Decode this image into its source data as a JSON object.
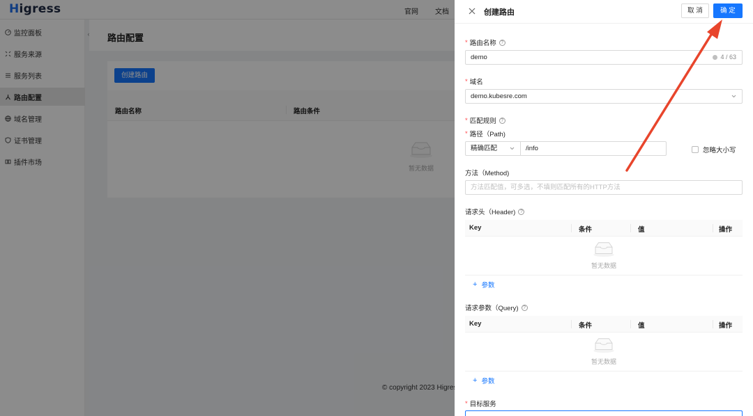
{
  "app": {
    "logo": {
      "first": "H",
      "rest": "igress"
    },
    "top_links": [
      "官网",
      "文档"
    ],
    "sidebar": {
      "items": [
        {
          "label": "监控面板",
          "icon": "dashboard-icon"
        },
        {
          "label": "服务来源",
          "icon": "source-icon"
        },
        {
          "label": "服务列表",
          "icon": "list-icon"
        },
        {
          "label": "路由配置",
          "icon": "route-icon",
          "active": true
        },
        {
          "label": "域名管理",
          "icon": "globe-icon"
        },
        {
          "label": "证书管理",
          "icon": "shield-icon"
        },
        {
          "label": "插件市场",
          "icon": "plugin-icon"
        }
      ]
    },
    "page_title": "路由配置",
    "create_button": "创建路由",
    "table": {
      "col_name": "路由名称",
      "col_condition": "路由条件",
      "empty_text": "暂无数据"
    },
    "copyright": "© copyright 2023 Higres"
  },
  "drawer": {
    "title": "创建路由",
    "cancel_label": "取 消",
    "ok_label": "确 定",
    "route_name": {
      "label": "路由名称",
      "value": "demo",
      "count": "4 / 63"
    },
    "domain": {
      "label": "域名",
      "value": "demo.kubesre.com"
    },
    "match_rule": {
      "label": "匹配规则"
    },
    "path": {
      "label": "路径（Path)",
      "match_type": "精确匹配",
      "value": "/info",
      "ignore_case_label": "忽略大小写"
    },
    "method": {
      "label": "方法（Method)",
      "placeholder": "方法匹配值，可多选，不填则匹配所有的HTTP方法"
    },
    "header": {
      "label": "请求头（Header)",
      "columns": [
        "Key",
        "条件",
        "值",
        "操作"
      ],
      "empty_text": "暂无数据",
      "add_label": "参数"
    },
    "query": {
      "label": "请求参数（Query)",
      "columns": [
        "Key",
        "条件",
        "值",
        "操作"
      ],
      "empty_text": "暂无数据",
      "add_label": "参数"
    },
    "target_service": {
      "label": "目标服务"
    }
  },
  "colors": {
    "primary": "#1677ff",
    "required": "#ff4d4f",
    "annotation_arrow": "#e8452c"
  }
}
